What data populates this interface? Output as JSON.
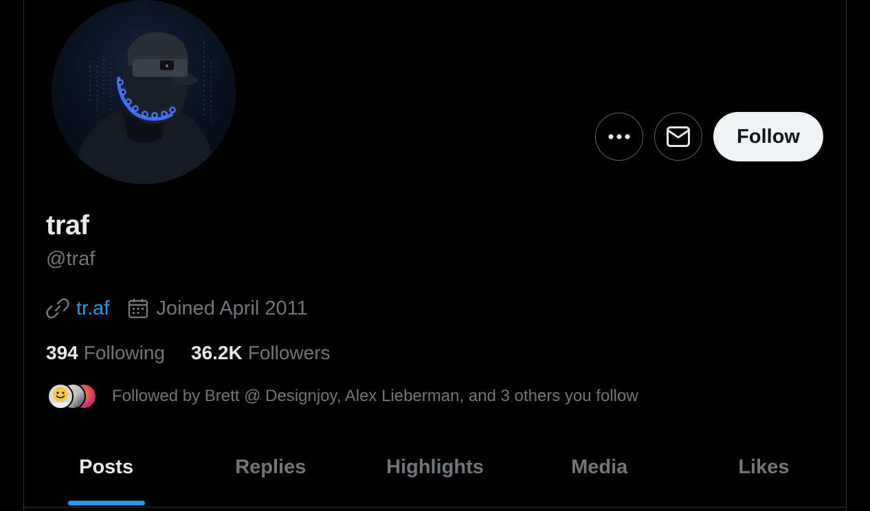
{
  "profile": {
    "display_name": "traf",
    "handle": "@traf",
    "website": "tr.af",
    "joined": "Joined April 2011"
  },
  "actions": {
    "more_icon": "more-horizontal-icon",
    "message_icon": "envelope-icon",
    "follow_label": "Follow"
  },
  "stats": {
    "following_count": "394",
    "following_label": "Following",
    "followers_count": "36.2K",
    "followers_label": "Followers"
  },
  "followed_by": {
    "text": "Followed by Brett @ Designjoy, Alex Lieberman, and 3 others you follow"
  },
  "tabs": [
    {
      "label": "Posts",
      "active": true
    },
    {
      "label": "Replies",
      "active": false
    },
    {
      "label": "Highlights",
      "active": false
    },
    {
      "label": "Media",
      "active": false
    },
    {
      "label": "Likes",
      "active": false
    }
  ],
  "colors": {
    "accent": "#1d9bf0",
    "background": "#000000",
    "text_primary": "#e7e9ea",
    "text_secondary": "#71767b"
  }
}
